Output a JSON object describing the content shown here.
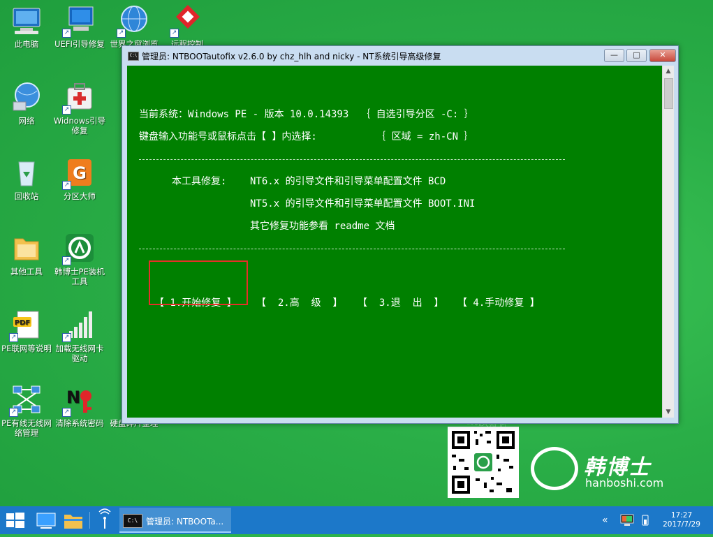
{
  "desktop_icons": [
    {
      "label": "此电脑",
      "icon": "computer-icon",
      "col": 0,
      "row": 0
    },
    {
      "label": "UEFI引导修复",
      "icon": "monitor-repair-icon",
      "col": 1,
      "row": 0
    },
    {
      "label": "世界之窗浏览",
      "icon": "globe-icon",
      "col": 2,
      "row": 0
    },
    {
      "label": "远程控制",
      "icon": "remote-control-icon",
      "col": 3,
      "row": 0
    },
    {
      "label": "网络",
      "icon": "network-globe-icon",
      "col": 0,
      "row": 1
    },
    {
      "label": "Widnows引导修复",
      "icon": "first-aid-kit-icon",
      "col": 1,
      "row": 1
    },
    {
      "label": "回收站",
      "icon": "recycle-bin-icon",
      "col": 0,
      "row": 2
    },
    {
      "label": "分区大师",
      "icon": "partition-icon",
      "col": 1,
      "row": 2
    },
    {
      "label": "其他工具",
      "icon": "folder-icon",
      "col": 0,
      "row": 3
    },
    {
      "label": "韩博士PE装机工具",
      "icon": "hanboshi-icon",
      "col": 1,
      "row": 3
    },
    {
      "label": "PE联网等说明",
      "icon": "pdf-icon",
      "col": 0,
      "row": 4
    },
    {
      "label": "加载无线网卡驱动",
      "icon": "wifi-signal-icon",
      "col": 1,
      "row": 4
    },
    {
      "label": "PE有线无线网络管理",
      "icon": "network-diagram-icon",
      "col": 0,
      "row": 5
    },
    {
      "label": "清除系统密码",
      "icon": "key-icon",
      "col": 1,
      "row": 5
    },
    {
      "label": "硬盘碎片整理",
      "icon": "defrag-icon",
      "col": 2,
      "row": 5
    }
  ],
  "window": {
    "title": "管理员: NTBOOTautofix v2.6.0 by chz_hlh and nicky - NT系统引导高级修复",
    "btn_min": "—",
    "btn_max": "□",
    "btn_close": "✕"
  },
  "console": {
    "line_system": "当前系统：Windows PE - 版本 10.0.14393  ｛ 自选引导分区 -C: ｝",
    "line_prompt": "键盘输入功能号或鼠标点击【 】内选择:          ｛ 区域 = zh-CN ｝",
    "repair_label": "本工具修复:",
    "repair_nt6": "NT6.x 的引导文件和引导菜单配置文件 BCD",
    "repair_nt5": "NT5.x 的引导文件和引导菜单配置文件 BOOT.INI",
    "repair_other": "其它修复功能参看 readme 文档",
    "menu": [
      "【 1.开始修复 】",
      "【  2.高  级  】",
      "【  3.退  出  】",
      "【 4.手动修复 】"
    ]
  },
  "brand": {
    "cn": "韩博士",
    "en": "hanboshi.com"
  },
  "taskbar": {
    "task_label": "管理员: NTBOOTa...",
    "time": "17:27",
    "date": "2017/7/29"
  },
  "colors": {
    "desktop": "#2cb34a",
    "console_bg": "#008000",
    "taskbar": "#1c78c9",
    "highlight": "#e53028"
  }
}
